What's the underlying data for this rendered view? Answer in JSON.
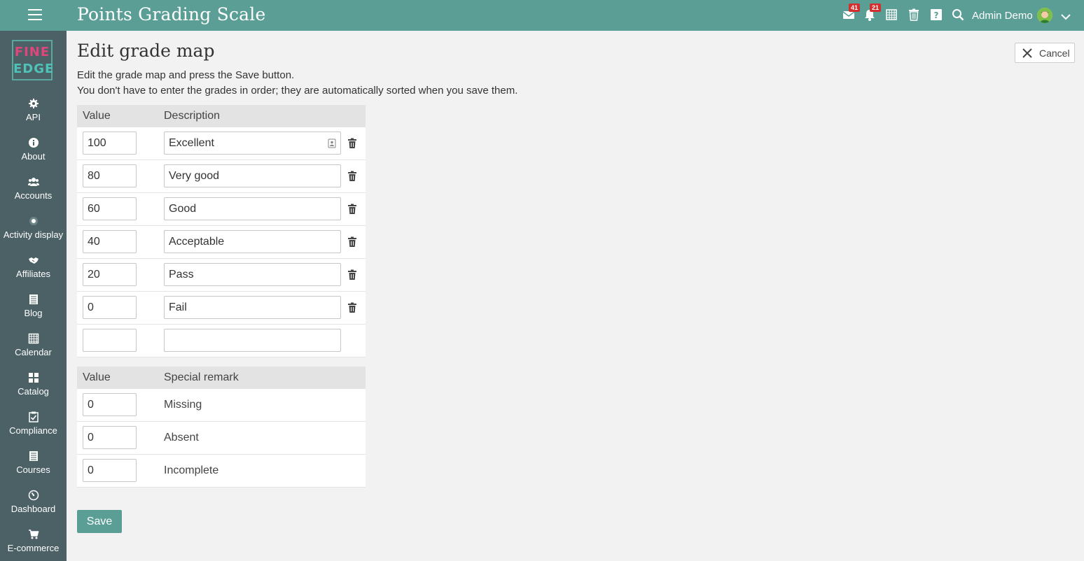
{
  "app": {
    "title": "Points Grading Scale",
    "colors": {
      "brand": "#5a9e96",
      "sidebar": "#4b6166",
      "badge": "#d32f2f"
    }
  },
  "header": {
    "mail_badge": "41",
    "notif_badge": "21",
    "user_name": "Admin Demo",
    "icons": [
      "menu-icon",
      "mail-icon",
      "bell-icon",
      "calendar-icon",
      "trash-icon",
      "help-icon",
      "search-icon",
      "chevron-down-icon"
    ]
  },
  "logo": {
    "line1": "FINE",
    "line2": "EDGE"
  },
  "sidebar": {
    "items": [
      {
        "label": "API",
        "icon": "gear-icon"
      },
      {
        "label": "About",
        "icon": "info-icon"
      },
      {
        "label": "Accounts",
        "icon": "users-icon"
      },
      {
        "label": "Activity display",
        "icon": "dot-icon"
      },
      {
        "label": "Affiliates",
        "icon": "handshake-icon"
      },
      {
        "label": "Blog",
        "icon": "blog-icon"
      },
      {
        "label": "Calendar",
        "icon": "calendar-icon"
      },
      {
        "label": "Catalog",
        "icon": "grid-icon"
      },
      {
        "label": "Compliance",
        "icon": "checklist-icon"
      },
      {
        "label": "Courses",
        "icon": "courses-icon"
      },
      {
        "label": "Dashboard",
        "icon": "dashboard-icon"
      },
      {
        "label": "E-commerce",
        "icon": "cart-icon"
      }
    ]
  },
  "page": {
    "title": "Edit grade map",
    "cancel_label": "Cancel",
    "intro_line1": "Edit the grade map and press the Save button.",
    "intro_line2": "You don't have to enter the grades in order; they are automatically sorted when you save them.",
    "save_label": "Save"
  },
  "grades": {
    "headers": {
      "value": "Value",
      "description": "Description"
    },
    "rows": [
      {
        "value": "100",
        "description": "Excellent"
      },
      {
        "value": "80",
        "description": "Very good"
      },
      {
        "value": "60",
        "description": "Good"
      },
      {
        "value": "40",
        "description": "Acceptable"
      },
      {
        "value": "20",
        "description": "Pass"
      },
      {
        "value": "0",
        "description": "Fail"
      },
      {
        "value": "",
        "description": ""
      }
    ]
  },
  "remarks": {
    "headers": {
      "value": "Value",
      "remark": "Special remark"
    },
    "rows": [
      {
        "value": "0",
        "remark": "Missing"
      },
      {
        "value": "0",
        "remark": "Absent"
      },
      {
        "value": "0",
        "remark": "Incomplete"
      }
    ]
  }
}
